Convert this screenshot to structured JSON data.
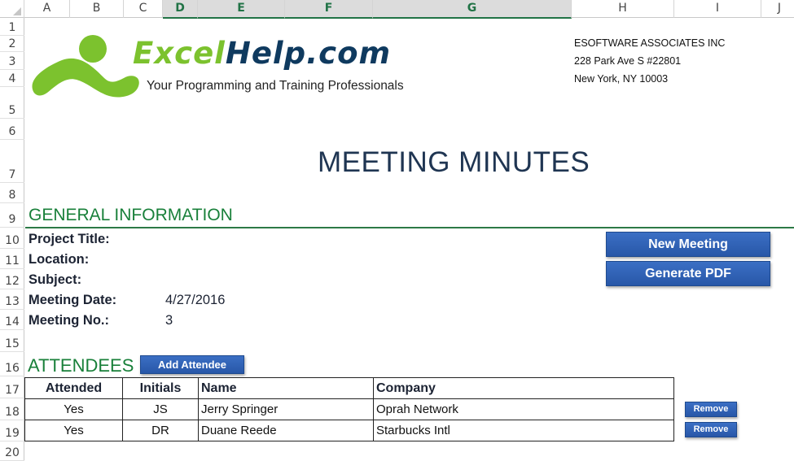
{
  "spreadsheet": {
    "columns": [
      {
        "label": "A",
        "selected": false
      },
      {
        "label": "B",
        "selected": false
      },
      {
        "label": "C",
        "selected": false
      },
      {
        "label": "D",
        "selected": true
      },
      {
        "label": "E",
        "selected": true
      },
      {
        "label": "F",
        "selected": true
      },
      {
        "label": "G",
        "selected": true
      },
      {
        "label": "H",
        "selected": false
      },
      {
        "label": "I",
        "selected": false
      },
      {
        "label": "J",
        "selected": false
      }
    ],
    "rows": [
      "1",
      "2",
      "3",
      "4",
      "5",
      "6",
      "7",
      "8",
      "9",
      "10",
      "11",
      "12",
      "13",
      "14",
      "15",
      "16",
      "17",
      "18",
      "19",
      "20"
    ]
  },
  "logo": {
    "icon": "running-figure-logo-icon",
    "word_green": "Excel",
    "word_blue": "Help.com",
    "tagline": "Your Programming and Training Professionals",
    "colors": {
      "green": "#7cc22e",
      "blue": "#0f3a5f"
    }
  },
  "company": {
    "name": "ESOFTWARE ASSOCIATES INC",
    "address1": "228 Park Ave S #22801",
    "address2": "New York, NY 10003"
  },
  "title": "MEETING MINUTES",
  "general": {
    "heading": "GENERAL INFORMATION",
    "fields": [
      {
        "label": "Project Title:",
        "value": ""
      },
      {
        "label": "Location:",
        "value": ""
      },
      {
        "label": "Subject:",
        "value": ""
      },
      {
        "label": "Meeting Date:",
        "value": "4/27/2016"
      },
      {
        "label": "Meeting No.:",
        "value": "3"
      }
    ]
  },
  "buttons": {
    "new_meeting": "New Meeting",
    "generate_pdf": "Generate PDF",
    "add_attendee": "Add Attendee",
    "remove": "Remove"
  },
  "attendees": {
    "heading": "ATTENDEES",
    "columns": [
      "Attended",
      "Initials",
      "Name",
      "Company"
    ],
    "rows": [
      {
        "attended": "Yes",
        "initials": "JS",
        "name": "Jerry Springer",
        "company": "Oprah Network"
      },
      {
        "attended": "Yes",
        "initials": "DR",
        "name": "Duane Reede",
        "company": "Starbucks Intl"
      }
    ]
  },
  "colors": {
    "section_green": "#19803a",
    "button_blue": "#2f63b8",
    "title_navy": "#1f3552",
    "selection_green": "#217346"
  }
}
